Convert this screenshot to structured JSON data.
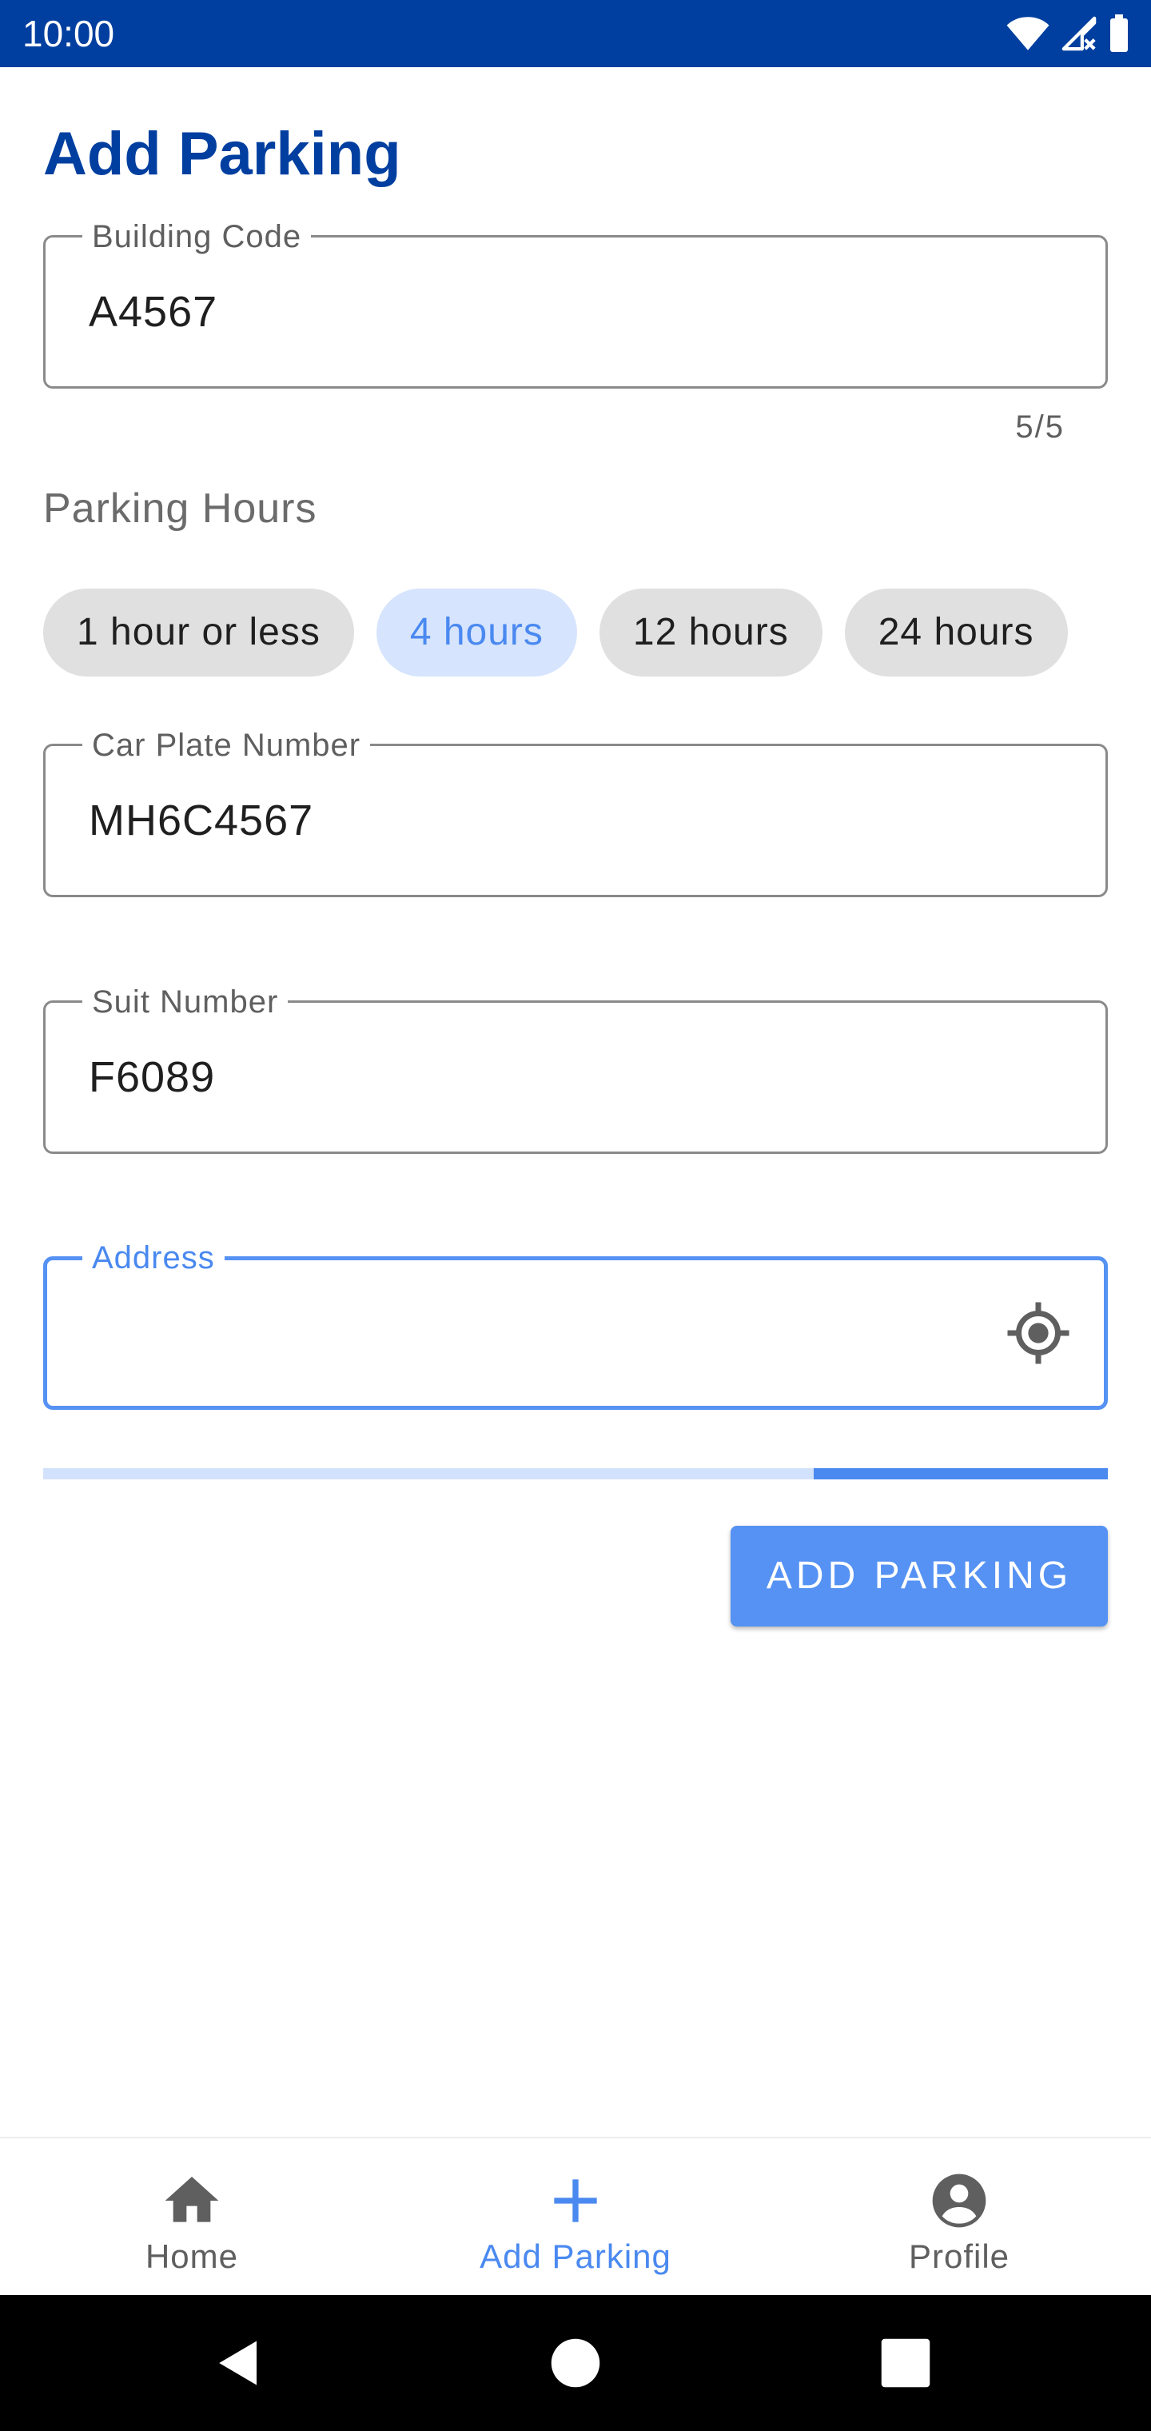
{
  "status_bar": {
    "time": "10:00",
    "icons": [
      "wifi-icon",
      "signal-icon",
      "battery-icon"
    ],
    "background": "#003fa0"
  },
  "page": {
    "title": "Add Parking"
  },
  "form": {
    "building_code": {
      "label": "Building Code",
      "value": "A4567",
      "counter": "5/5"
    },
    "parking_hours": {
      "label": "Parking Hours",
      "options": [
        "1 hour or less",
        "4 hours",
        "12 hours",
        "24 hours"
      ],
      "selected": "4 hours"
    },
    "car_plate": {
      "label": "Car Plate Number",
      "value": "MH6C4567"
    },
    "suit_number": {
      "label": "Suit Number",
      "value": "F6089"
    },
    "address": {
      "label": "Address",
      "value": "",
      "icon": "my-location-icon",
      "focused": true
    },
    "progress": {
      "indeterminate": true,
      "fill_start_fraction": 0.724,
      "fill_end_fraction": 1.0
    },
    "submit_label": "ADD PARKING"
  },
  "bottom_nav": {
    "items": [
      {
        "label": "Home",
        "icon": "home-icon",
        "active": false
      },
      {
        "label": "Add Parking",
        "icon": "add-icon",
        "active": true
      },
      {
        "label": "Profile",
        "icon": "account-circle-icon",
        "active": false
      }
    ]
  },
  "system_nav": {
    "buttons": [
      "back-icon",
      "home-circle-icon",
      "recents-icon"
    ]
  },
  "colors": {
    "primary": "#003fa0",
    "accent": "#4a89f0",
    "button": "#5592f3",
    "chip_selected_bg": "#d6e4fd",
    "chip_bg": "#e0e0e0",
    "progress_track": "#d3e2fc"
  }
}
